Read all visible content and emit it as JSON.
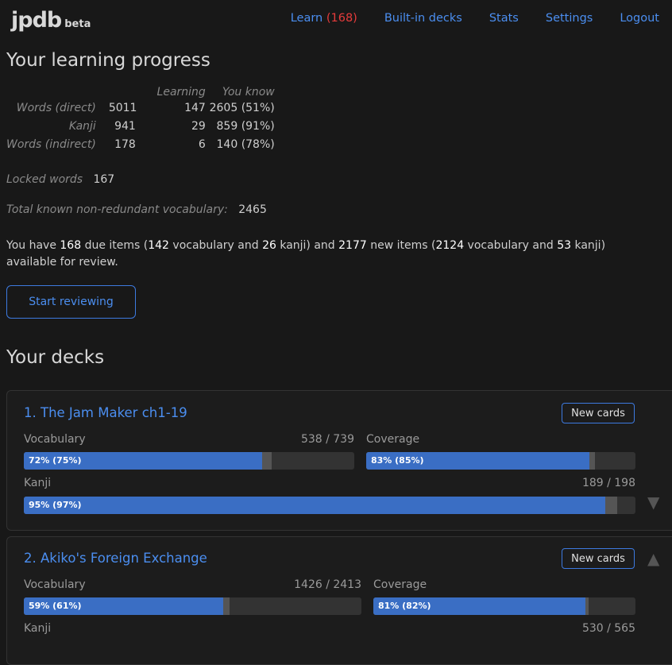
{
  "header": {
    "logo": "jpdb",
    "logo_sub": "beta",
    "nav": {
      "learn": "Learn",
      "learn_count": "(168)",
      "decks": "Built-in decks",
      "stats": "Stats",
      "settings": "Settings",
      "logout": "Logout"
    }
  },
  "progress": {
    "title": "Your learning progress",
    "columns": [
      "",
      "",
      "Learning",
      "You know"
    ],
    "rows": [
      {
        "label": "Words (direct)",
        "total": "5011",
        "learning": "147",
        "known": "2605 (51%)"
      },
      {
        "label": "Kanji",
        "total": "941",
        "learning": "29",
        "known": "859 (91%)"
      },
      {
        "label": "Words (indirect)",
        "total": "178",
        "learning": "6",
        "known": "140 (78%)"
      }
    ],
    "locked_label": "Locked words",
    "locked": "167",
    "total_label": "Total known non-redundant vocabulary:",
    "total": "2465",
    "due": {
      "t1": "You have ",
      "due": "168",
      "t2": " due items (",
      "vocab": "142",
      "t3": " vocabulary and ",
      "kanji": "26",
      "t4": " kanji) and ",
      "new": "2177",
      "t5": " new items (",
      "new_vocab": "2124",
      "t6": " vocabulary and ",
      "new_kanji": "53",
      "t7": " kanji) available for review."
    },
    "start_button": "Start reviewing"
  },
  "decks": {
    "title": "Your decks",
    "items": [
      {
        "name": "1. The Jam Maker ch1-19",
        "new_cards": "New cards",
        "vocab_label": "Vocabulary",
        "vocab_count": "538 / 739",
        "vocab_pct": "72% (75%)",
        "vocab_fill": [
          72,
          75
        ],
        "coverage_label": "Coverage",
        "coverage_pct": "83% (85%)",
        "coverage_fill": [
          83,
          85
        ],
        "kanji_label": "Kanji",
        "kanji_count": "189 / 198",
        "kanji_pct": "95% (97%)",
        "kanji_fill": [
          95,
          97
        ]
      },
      {
        "name": "2. Akiko's Foreign Exchange",
        "new_cards": "New cards",
        "vocab_label": "Vocabulary",
        "vocab_count": "1426 / 2413",
        "vocab_pct": "59% (61%)",
        "vocab_fill": [
          59,
          61
        ],
        "coverage_label": "Coverage",
        "coverage_pct": "81% (82%)",
        "coverage_fill": [
          81,
          82
        ],
        "kanji_label": "Kanji",
        "kanji_count": "530 / 565"
      }
    ]
  }
}
